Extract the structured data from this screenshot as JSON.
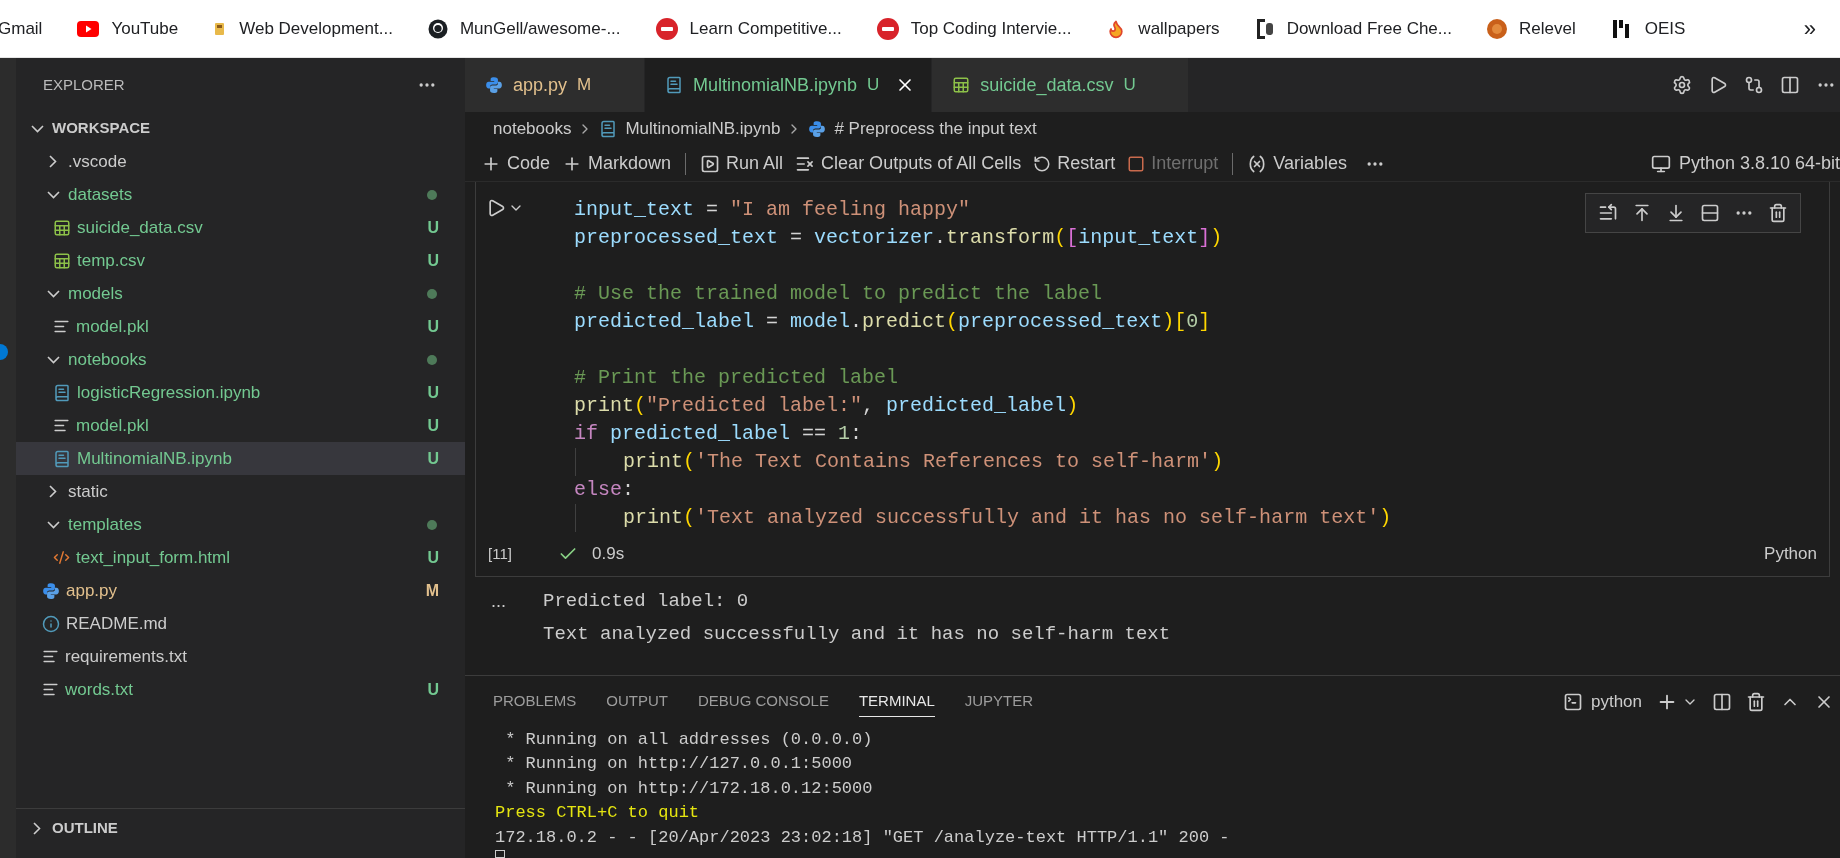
{
  "bookmarks": [
    {
      "label": "Gmail",
      "kind": "none"
    },
    {
      "label": "YouTube",
      "kind": "youtube"
    },
    {
      "label": "Web Development...",
      "kind": "cup"
    },
    {
      "label": "MunGell/awesome-...",
      "kind": "github"
    },
    {
      "label": "Learn Competitive...",
      "kind": "tuf"
    },
    {
      "label": "Top Coding Intervie...",
      "kind": "tuf"
    },
    {
      "label": "wallpapers",
      "kind": "fire"
    },
    {
      "label": "Download Free Che...",
      "kind": "bracket"
    },
    {
      "label": "Relevel",
      "kind": "rb"
    },
    {
      "label": "OEIS",
      "kind": "oeis"
    }
  ],
  "bookmarks_more": "»",
  "explorer": {
    "title": "EXPLORER",
    "root": {
      "name": "WORKSPACE",
      "expanded": true
    },
    "tree": [
      {
        "kind": "folder",
        "name": ".vscode",
        "expanded": false,
        "color": "#cccccc",
        "dot": false,
        "selected": false
      },
      {
        "kind": "folder",
        "name": "datasets",
        "expanded": true,
        "color": "#73c991",
        "dot": true,
        "selected": false,
        "children": [
          {
            "kind": "csv",
            "name": "suicide_data.csv",
            "color": "#73c991",
            "status": "U",
            "selected": false
          },
          {
            "kind": "csv",
            "name": "temp.csv",
            "color": "#73c991",
            "status": "U",
            "selected": false
          }
        ]
      },
      {
        "kind": "folder",
        "name": "models",
        "expanded": true,
        "color": "#73c991",
        "dot": true,
        "selected": false,
        "children": [
          {
            "kind": "lines",
            "name": "model.pkl",
            "color": "#73c991",
            "status": "U",
            "selected": false
          }
        ]
      },
      {
        "kind": "folder",
        "name": "notebooks",
        "expanded": true,
        "color": "#73c991",
        "dot": true,
        "selected": false,
        "children": [
          {
            "kind": "notebook",
            "name": "logisticRegression.ipynb",
            "color": "#73c991",
            "status": "U",
            "selected": false
          },
          {
            "kind": "lines",
            "name": "model.pkl",
            "color": "#73c991",
            "status": "U",
            "selected": false
          },
          {
            "kind": "notebook",
            "name": "MultinomialNB.ipynb",
            "color": "#73c991",
            "status": "U",
            "selected": true
          }
        ]
      },
      {
        "kind": "folder",
        "name": "static",
        "expanded": false,
        "color": "#cccccc",
        "dot": false,
        "selected": false
      },
      {
        "kind": "folder",
        "name": "templates",
        "expanded": true,
        "color": "#73c991",
        "dot": true,
        "selected": false,
        "children": [
          {
            "kind": "html",
            "name": "text_input_form.html",
            "color": "#73c991",
            "status": "U",
            "selected": false
          }
        ]
      },
      {
        "kind": "python",
        "name": "app.py",
        "color": "#e2c08d",
        "status": "M",
        "selected": false
      },
      {
        "kind": "info",
        "name": "README.md",
        "color": "#cccccc",
        "selected": false
      },
      {
        "kind": "lines",
        "name": "requirements.txt",
        "color": "#cccccc",
        "selected": false
      },
      {
        "kind": "lines",
        "name": "words.txt",
        "color": "#73c991",
        "status": "U",
        "selected": false
      }
    ],
    "outline": {
      "name": "OUTLINE",
      "expanded": false
    }
  },
  "tabs": [
    {
      "label": "app.py",
      "kind": "python",
      "color": "#e2c08d",
      "status": "M",
      "selected": false
    },
    {
      "label": "MultinomialNB.ipynb",
      "kind": "notebook",
      "color": "#73c991",
      "status": "U",
      "selected": true
    },
    {
      "label": "suicide_data.csv",
      "kind": "csv",
      "color": "#73c991",
      "status": "U",
      "selected": false
    }
  ],
  "breadcrumbs": [
    {
      "label": "notebooks",
      "kind": "none"
    },
    {
      "label": "MultinomialNB.ipynb",
      "kind": "notebook"
    },
    {
      "label": "# Preprocess the input text",
      "kind": "python"
    }
  ],
  "toolbar": [
    {
      "label": "Code",
      "kind": "plus",
      "disabled": false,
      "divider_before": false
    },
    {
      "label": "Markdown",
      "kind": "plus",
      "disabled": false,
      "divider_before": false
    },
    {
      "label": "Run All",
      "kind": "runall",
      "disabled": false,
      "divider_before": true
    },
    {
      "label": "Clear Outputs of All Cells",
      "kind": "clear",
      "disabled": false,
      "divider_before": false
    },
    {
      "label": "Restart",
      "kind": "restart",
      "disabled": false,
      "divider_before": false
    },
    {
      "label": "Interrupt",
      "kind": "stop",
      "disabled": true,
      "divider_before": false
    },
    {
      "label": "Variables",
      "kind": "variables",
      "disabled": false,
      "divider_before": true
    }
  ],
  "kernel": "Python 3.8.10 64-bit",
  "cell": {
    "execution_count": "[11]",
    "duration": "0.9s",
    "succeeded": true,
    "language": "Python",
    "lines": [
      {
        "kind": "code",
        "indented": false,
        "tokens": [
          {
            "text": "input_text",
            "kind": "var"
          },
          {
            "text": " = ",
            "kind": "plain"
          },
          {
            "text": "\"I am feeling happy\"",
            "kind": "string"
          }
        ]
      },
      {
        "kind": "code",
        "indented": false,
        "tokens": [
          {
            "text": "preprocessed_text",
            "kind": "var"
          },
          {
            "text": " = ",
            "kind": "plain"
          },
          {
            "text": "vectorizer",
            "kind": "var"
          },
          {
            "text": ".",
            "kind": "plain"
          },
          {
            "text": "transform",
            "kind": "func"
          },
          {
            "text": "(",
            "kind": "br1"
          },
          {
            "text": "[",
            "kind": "br2"
          },
          {
            "text": "input_text",
            "kind": "var"
          },
          {
            "text": "]",
            "kind": "br2"
          },
          {
            "text": ")",
            "kind": "br1"
          }
        ]
      },
      {
        "kind": "blank"
      },
      {
        "kind": "code",
        "indented": false,
        "tokens": [
          {
            "text": "# Use the trained model to predict the label",
            "kind": "comment"
          }
        ]
      },
      {
        "kind": "code",
        "indented": false,
        "tokens": [
          {
            "text": "predicted_label",
            "kind": "var"
          },
          {
            "text": " = ",
            "kind": "plain"
          },
          {
            "text": "model",
            "kind": "var"
          },
          {
            "text": ".",
            "kind": "plain"
          },
          {
            "text": "predict",
            "kind": "func"
          },
          {
            "text": "(",
            "kind": "br1"
          },
          {
            "text": "preprocessed_text",
            "kind": "var"
          },
          {
            "text": ")",
            "kind": "br1"
          },
          {
            "text": "[",
            "kind": "br1"
          },
          {
            "text": "0",
            "kind": "num"
          },
          {
            "text": "]",
            "kind": "br1"
          }
        ]
      },
      {
        "kind": "blank"
      },
      {
        "kind": "code",
        "indented": false,
        "tokens": [
          {
            "text": "# Print the predicted label",
            "kind": "comment"
          }
        ]
      },
      {
        "kind": "code",
        "indented": false,
        "tokens": [
          {
            "text": "print",
            "kind": "func"
          },
          {
            "text": "(",
            "kind": "br1"
          },
          {
            "text": "\"Predicted label:\"",
            "kind": "string"
          },
          {
            "text": ", ",
            "kind": "plain"
          },
          {
            "text": "predicted_label",
            "kind": "var"
          },
          {
            "text": ")",
            "kind": "br1"
          }
        ]
      },
      {
        "kind": "code",
        "indented": false,
        "tokens": [
          {
            "text": "if ",
            "kind": "keyword"
          },
          {
            "text": "predicted_label",
            "kind": "var"
          },
          {
            "text": " == ",
            "kind": "plain"
          },
          {
            "text": "1",
            "kind": "num"
          },
          {
            "text": ":",
            "kind": "plain"
          }
        ]
      },
      {
        "kind": "code",
        "indented": true,
        "tokens": [
          {
            "text": "print",
            "kind": "func"
          },
          {
            "text": "(",
            "kind": "br1"
          },
          {
            "text": "'The Text Contains References to self-harm'",
            "kind": "string"
          },
          {
            "text": ")",
            "kind": "br1"
          }
        ]
      },
      {
        "kind": "code",
        "indented": false,
        "tokens": [
          {
            "text": "else",
            "kind": "keyword"
          },
          {
            "text": ":",
            "kind": "plain"
          }
        ]
      },
      {
        "kind": "code",
        "indented": true,
        "tokens": [
          {
            "text": "print",
            "kind": "func"
          },
          {
            "text": "(",
            "kind": "br1"
          },
          {
            "text": "'Text analyzed successfully and it has no self-harm text'",
            "kind": "string"
          },
          {
            "text": ")",
            "kind": "br1"
          }
        ]
      }
    ],
    "output_marker": "...",
    "output": [
      "Predicted label: 0",
      "Text analyzed successfully and it has no self-harm text"
    ]
  },
  "panel": {
    "tabs": [
      {
        "label": "PROBLEMS",
        "selected": false
      },
      {
        "label": "OUTPUT",
        "selected": false
      },
      {
        "label": "DEBUG CONSOLE",
        "selected": false
      },
      {
        "label": "TERMINAL",
        "selected": true
      },
      {
        "label": "JUPYTER",
        "selected": false
      }
    ],
    "terminal_name": "python",
    "lines": [
      {
        "text": " * Running on all addresses (0.0.0.0)",
        "kind": "plain"
      },
      {
        "text": " * Running on http://127.0.0.1:5000",
        "kind": "plain"
      },
      {
        "text": " * Running on http://172.18.0.12:5000",
        "kind": "plain"
      },
      {
        "text": "Press CTRL+C to quit",
        "kind": "highlight"
      },
      {
        "text": "172.18.0.2 - - [20/Apr/2023 23:02:18] \"GET /analyze-text HTTP/1.1\" 200 -",
        "kind": "plain"
      }
    ]
  }
}
